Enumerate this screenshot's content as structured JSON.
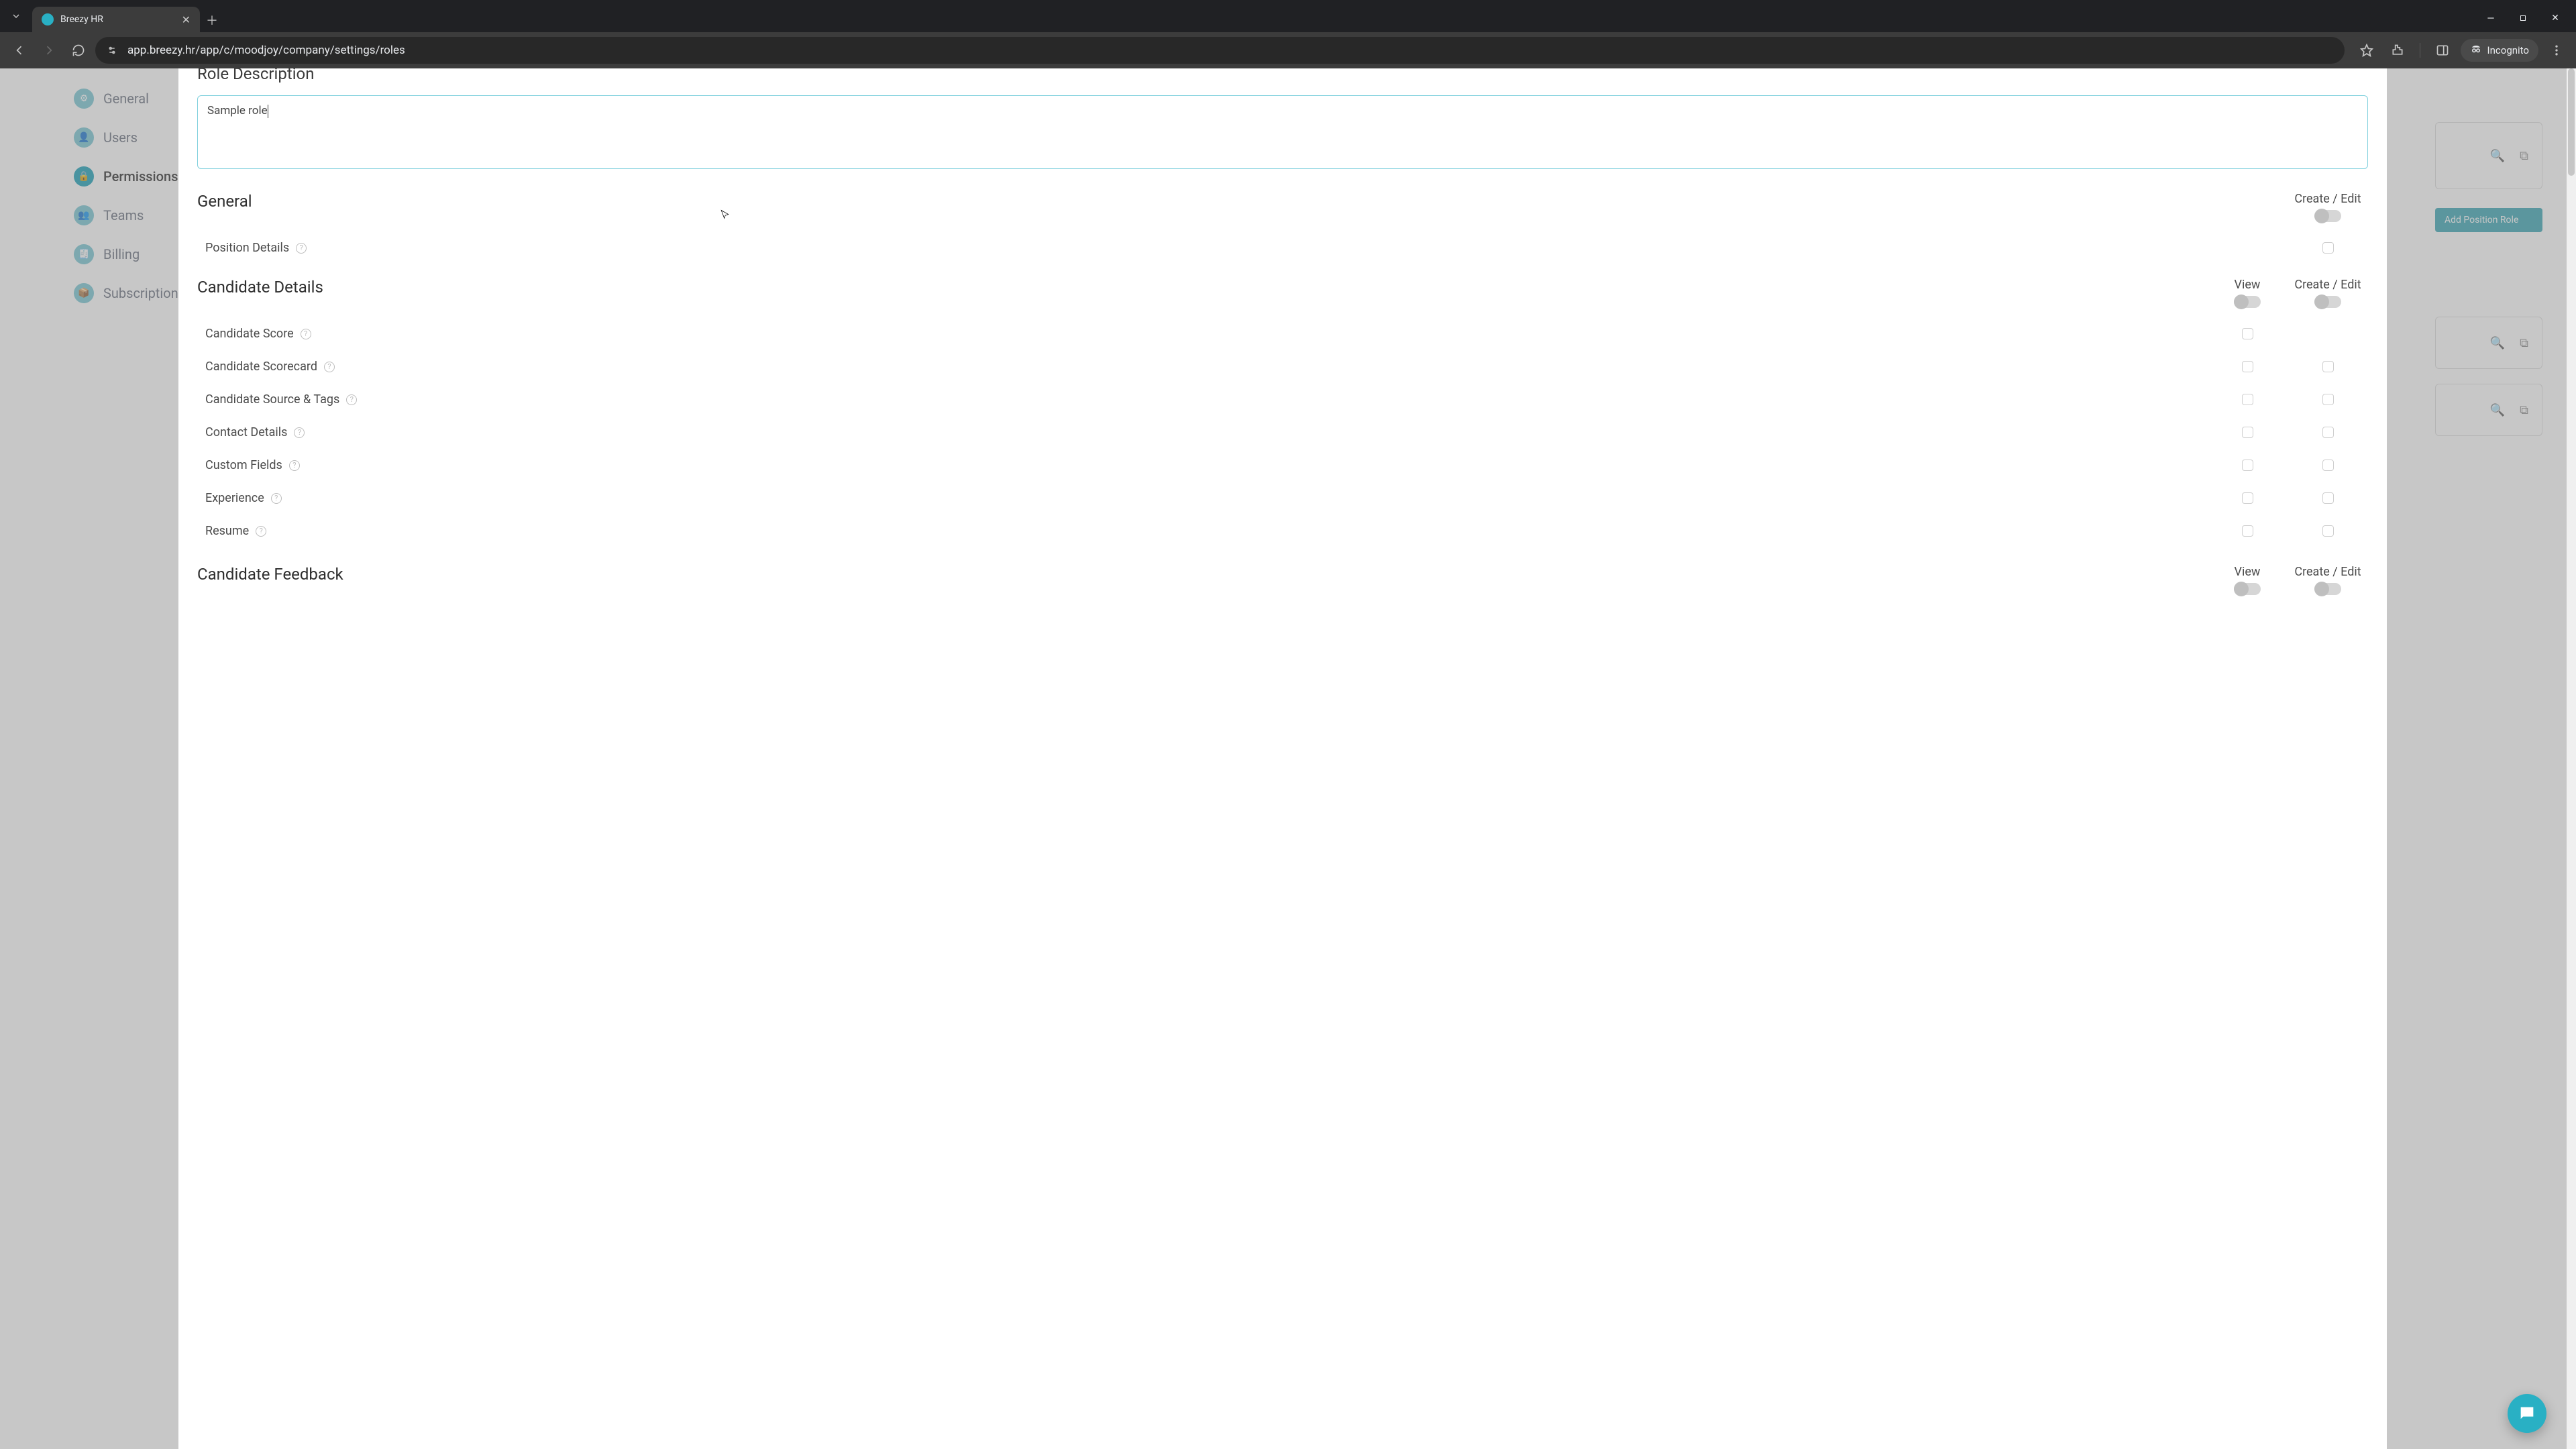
{
  "browser": {
    "tab_title": "Breezy HR",
    "url": "app.breezy.hr/app/c/moodjoy/company/settings/roles",
    "incognito_label": "Incognito"
  },
  "sidebar": {
    "items": [
      {
        "label": "General"
      },
      {
        "label": "Users"
      },
      {
        "label": "Permissions"
      },
      {
        "label": "Teams"
      },
      {
        "label": "Billing"
      },
      {
        "label": "Subscriptions"
      }
    ]
  },
  "background": {
    "add_position_role": "Add Position Role"
  },
  "modal": {
    "role_description_title": "Role Description",
    "role_description_value": "Sample role",
    "col_view": "View",
    "col_create_edit": "Create / Edit",
    "sections": {
      "general": {
        "title": "General",
        "rows": [
          {
            "label": "Position Details"
          }
        ]
      },
      "candidate_details": {
        "title": "Candidate Details",
        "rows": [
          {
            "label": "Candidate Score"
          },
          {
            "label": "Candidate Scorecard"
          },
          {
            "label": "Candidate Source & Tags"
          },
          {
            "label": "Contact Details"
          },
          {
            "label": "Custom Fields"
          },
          {
            "label": "Experience"
          },
          {
            "label": "Resume"
          }
        ]
      },
      "candidate_feedback": {
        "title": "Candidate Feedback"
      }
    }
  }
}
